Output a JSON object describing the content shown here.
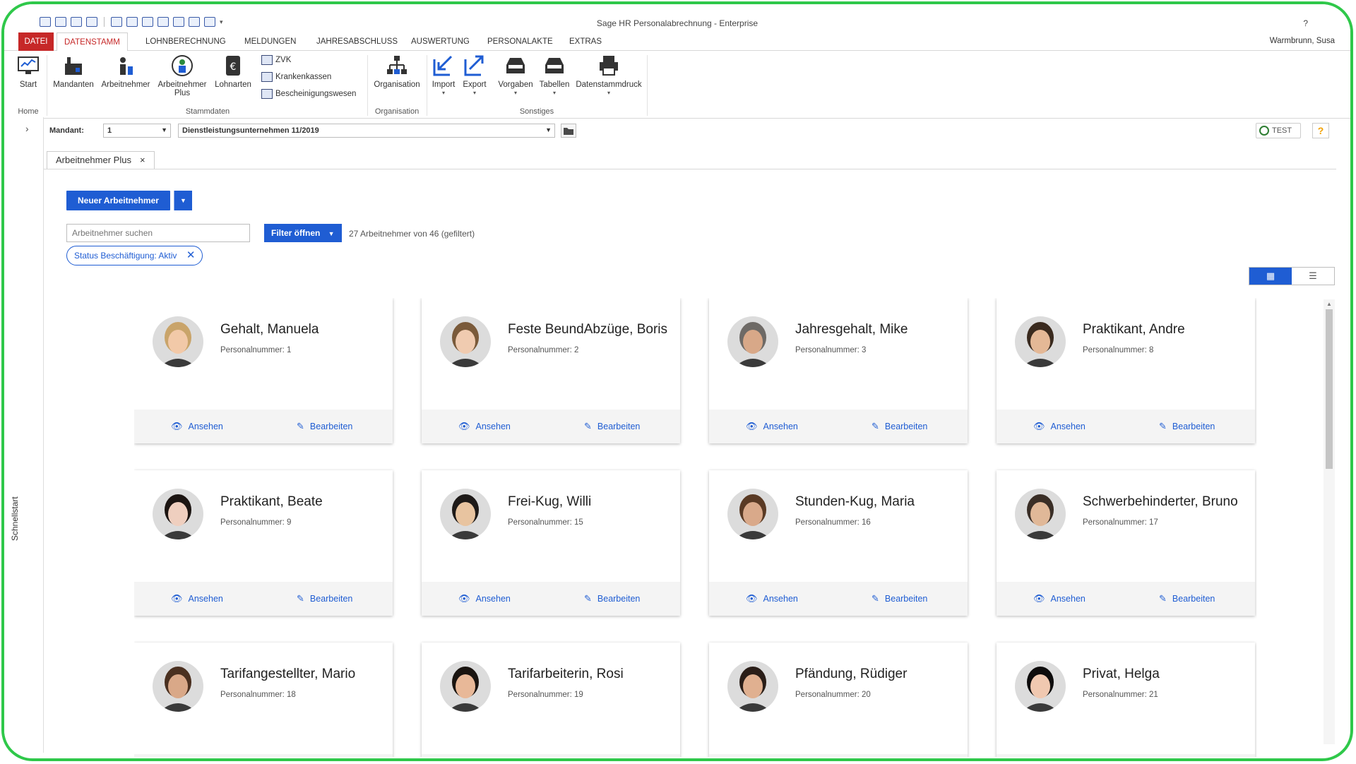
{
  "app": {
    "title": "Sage HR Personalabrechnung - Enterprise",
    "help": "?",
    "user": "Warmbrunn, Susa"
  },
  "ribbon_tabs": [
    "DATEI",
    "DATENSTAMM",
    "LOHNBERECHNUNG",
    "MELDUNGEN",
    "JAHRESABSCHLUSS",
    "AUSWERTUNG",
    "PERSONALAKTE",
    "EXTRAS"
  ],
  "ribbon": {
    "home": {
      "start": "Start",
      "group": "Home"
    },
    "stammdaten": {
      "mandanten": "Mandanten",
      "arbeitnehmer": "Arbeitnehmer",
      "arbeitnehmer_plus_1": "Arbeitnehmer",
      "arbeitnehmer_plus_2": "Plus",
      "lohnarten": "Lohnarten",
      "zvk": "ZVK",
      "krankenkassen": "Krankenkassen",
      "bescheinigungswesen": "Bescheinigungswesen",
      "group": "Stammdaten"
    },
    "organisation": {
      "organisation": "Organisation",
      "group": "Organisation"
    },
    "sonstiges": {
      "import": "Import",
      "export": "Export",
      "vorgaben": "Vorgaben",
      "tabellen": "Tabellen",
      "datenstammdruck": "Datenstammdruck",
      "group": "Sonstiges"
    }
  },
  "mandant": {
    "label": "Mandant:",
    "value": "1",
    "company": "Dienstleistungsunternehmen 11/2019",
    "test": "TEST",
    "help": "?"
  },
  "sidebar": {
    "label": "Schnellstart"
  },
  "doc_tab": {
    "label": "Arbeitnehmer Plus",
    "close": "×"
  },
  "toolbar": {
    "new_employee": "Neuer Arbeitnehmer",
    "search_placeholder": "Arbeitnehmer suchen",
    "filter_open": "Filter öffnen",
    "filter_count": "27 Arbeitnehmer von 46 (gefiltert)",
    "chip": "Status Beschäftigung: Aktiv"
  },
  "card_labels": {
    "view": "Ansehen",
    "edit": "Bearbeiten"
  },
  "employees": [
    {
      "name": "Gehalt, Manuela",
      "pn": "Personalnummer: 1",
      "hair": "#c9a46a",
      "skin": "#f2c9a8"
    },
    {
      "name": "Feste BeundAbzüge, Boris",
      "pn": "Personalnummer: 2",
      "hair": "#7a5a3a",
      "skin": "#f0cbb0"
    },
    {
      "name": "Jahresgehalt, Mike",
      "pn": "Personalnummer: 3",
      "hair": "#6e6a66",
      "skin": "#d8a888"
    },
    {
      "name": "Praktikant, Andre",
      "pn": "Personalnummer: 8",
      "hair": "#3a2a1e",
      "skin": "#e4b896"
    },
    {
      "name": "Praktikant, Beate",
      "pn": "Personalnummer: 9",
      "hair": "#1c1512",
      "skin": "#efcfbf"
    },
    {
      "name": "Frei-Kug, Willi",
      "pn": "Personalnummer: 15",
      "hair": "#1e1a18",
      "skin": "#e8c4a0"
    },
    {
      "name": "Stunden-Kug, Maria",
      "pn": "Personalnummer: 16",
      "hair": "#5a3a24",
      "skin": "#d9a98a"
    },
    {
      "name": "Schwerbehinderter, Bruno",
      "pn": "Personalnummer: 17",
      "hair": "#3a2e26",
      "skin": "#e0b898"
    },
    {
      "name": "Tarifangestellter, Mario",
      "pn": "Personalnummer: 18",
      "hair": "#4a3020",
      "skin": "#d9a888"
    },
    {
      "name": "Tarifarbeiterin, Rosi",
      "pn": "Personalnummer: 19",
      "hair": "#1a1410",
      "skin": "#e8b898"
    },
    {
      "name": "Pfändung, Rüdiger",
      "pn": "Personalnummer: 20",
      "hair": "#2a1e18",
      "skin": "#e0b090"
    },
    {
      "name": "Privat, Helga",
      "pn": "Personalnummer: 21",
      "hair": "#0e0c0c",
      "skin": "#f0c8b0"
    }
  ],
  "colors": {
    "accent": "#1f5dd3",
    "file_tab": "#c62828",
    "frame": "#2fc84a"
  }
}
